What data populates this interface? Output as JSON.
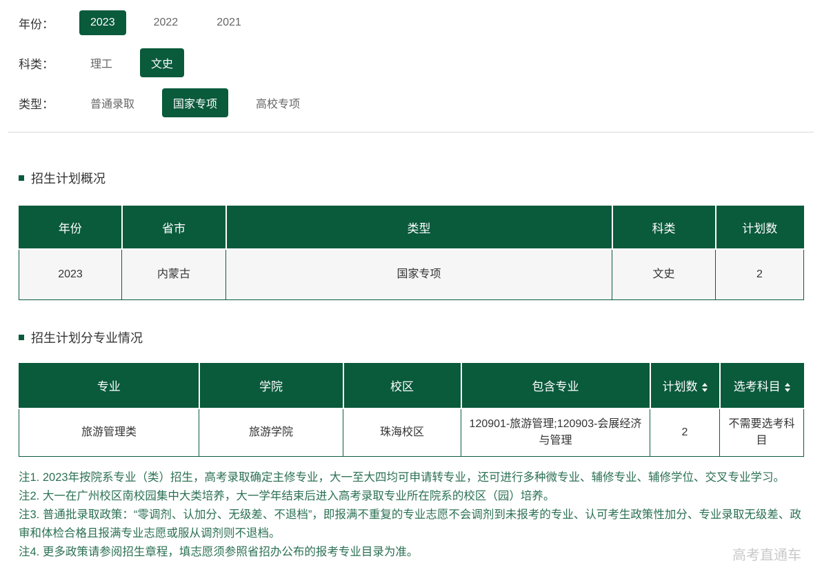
{
  "theme": {
    "brand_green": "#0a5a3c",
    "note_green": "#2b7053",
    "page_bg": "#ffffff",
    "row_bg_gray": "#f6f6f6",
    "text_dark": "#333333",
    "text_muted": "#666666",
    "divider_gray": "#d9d9d9",
    "watermark_gray": "#c9c9c9"
  },
  "filters": [
    {
      "label": "年份：",
      "options": [
        {
          "label": "2023",
          "selected": true
        },
        {
          "label": "2022",
          "selected": false
        },
        {
          "label": "2021",
          "selected": false
        }
      ]
    },
    {
      "label": "科类：",
      "options": [
        {
          "label": "理工",
          "selected": false
        },
        {
          "label": "文史",
          "selected": true
        }
      ]
    },
    {
      "label": "类型：",
      "options": [
        {
          "label": "普通录取",
          "selected": false
        },
        {
          "label": "国家专项",
          "selected": true
        },
        {
          "label": "高校专项",
          "selected": false
        }
      ]
    }
  ],
  "overview_section": {
    "title": "招生计划概况",
    "table": {
      "headers": [
        "年份",
        "省市",
        "类型",
        "科类",
        "计划数"
      ],
      "rows": [
        [
          "2023",
          "内蒙古",
          "国家专项",
          "文史",
          "2"
        ]
      ]
    }
  },
  "majors_section": {
    "title": "招生计划分专业情况",
    "table": {
      "headers": [
        "专业",
        "学院",
        "校区",
        "包含专业",
        "计划数",
        "选考科目"
      ],
      "sortable_columns": [
        "计划数",
        "选考科目"
      ],
      "rows": [
        [
          "旅游管理类",
          "旅游学院",
          "珠海校区",
          "120901-旅游管理;120903-会展经济与管理",
          "2",
          "不需要选考科目"
        ]
      ]
    }
  },
  "notes": [
    "注1. 2023年按院系专业（类）招生，高考录取确定主修专业，大一至大四均可申请转专业，还可进行多种微专业、辅修专业、辅修学位、交叉专业学习。",
    "注2. 大一在广州校区南校园集中大类培养，大一学年结束后进入高考录取专业所在院系的校区（园）培养。",
    "注3. 普通批录取政策：“零调剂、认加分、无级差、不退档”，即报满不重复的专业志愿不会调剂到未报考的专业、认可考生政策性加分、专业录取无级差、政审和体检合格且报满专业志愿或服从调剂则不退档。",
    "注4. 更多政策请参阅招生章程，填志愿须参照省招办公布的报考专业目录为准。"
  ],
  "watermark": "高考直通车"
}
